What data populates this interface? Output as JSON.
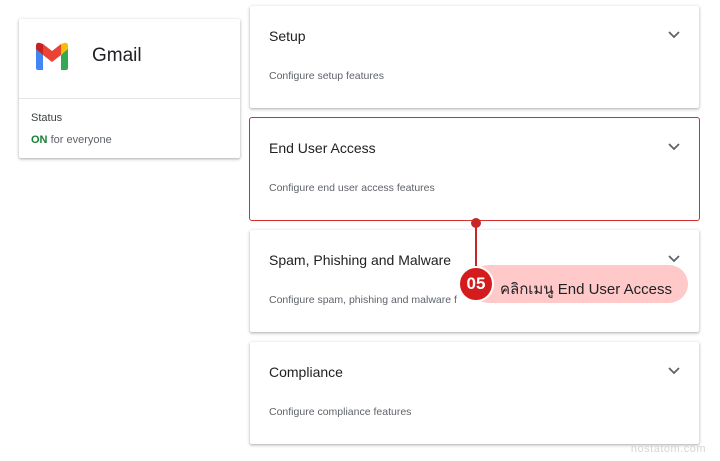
{
  "app": {
    "name": "Gmail",
    "status_label": "Status",
    "status_value": "ON",
    "status_scope": "for everyone",
    "logo_icon": "gmail-logo-icon"
  },
  "sections": [
    {
      "title": "Setup",
      "description": "Configure setup features",
      "icon": "chevron-down-icon"
    },
    {
      "title": "End User Access",
      "description": "Configure end user access features",
      "icon": "chevron-down-icon"
    },
    {
      "title": "Spam, Phishing and Malware",
      "description": "Configure spam, phishing and malware f",
      "icon": "chevron-down-icon"
    },
    {
      "title": "Compliance",
      "description": "Configure compliance features",
      "icon": "chevron-down-icon"
    }
  ],
  "callout": {
    "step": "05",
    "text": "คลิกเมนู End User Access",
    "color": "#d41c1c"
  },
  "watermark": "hostatom.com"
}
